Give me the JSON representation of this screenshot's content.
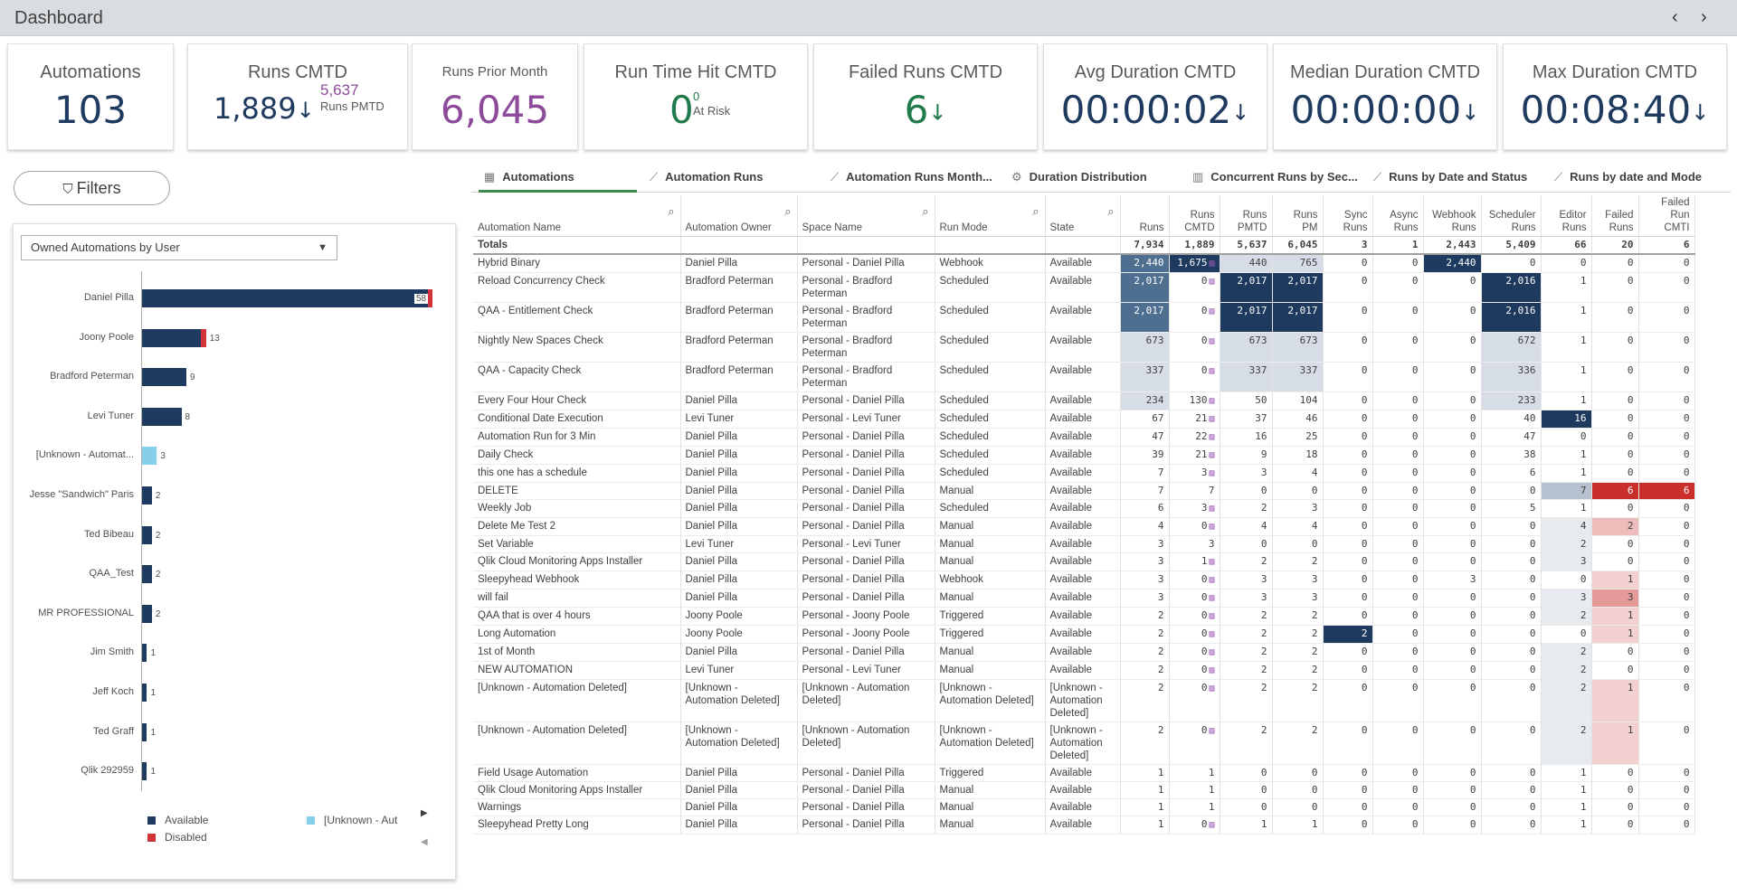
{
  "topbar": {
    "title": "Dashboard",
    "prev_icon": "‹",
    "next_icon": "›"
  },
  "kpis": [
    {
      "label": "Automations",
      "value": "103",
      "arrow": "",
      "sub_value": "",
      "sub_label": "",
      "value_color": "#1e3a5f"
    },
    {
      "label": "Runs CMTD",
      "value": "1,889",
      "arrow": "↓",
      "sub_value": "5,637",
      "sub_label": "Runs PMTD",
      "value_color": "#1e3a5f"
    },
    {
      "label": "Runs Prior Month",
      "value": "6,045",
      "arrow": "",
      "sub_value": "",
      "sub_label": "",
      "value_color": "#8e4a9a"
    },
    {
      "label": "Run Time Hit CMTD",
      "value": "0",
      "arrow": "",
      "sub_value": "0",
      "sub_label": "At Risk",
      "value_color": "#1f7a4c"
    },
    {
      "label": "Failed Runs CMTD",
      "value": "6",
      "arrow": "↓",
      "sub_value": "",
      "sub_label": "",
      "value_color": "#1f7a4c"
    },
    {
      "label": "Avg Duration CMTD",
      "value": "00:00:02",
      "arrow": "↓",
      "sub_value": "",
      "sub_label": "",
      "value_color": "#1e3a5f"
    },
    {
      "label": "Median Duration CMTD",
      "value": "00:00:00",
      "arrow": "↓",
      "sub_value": "",
      "sub_label": "",
      "value_color": "#1e3a5f"
    },
    {
      "label": "Max Duration CMTD",
      "value": "00:08:40",
      "arrow": "↓",
      "sub_value": "",
      "sub_label": "",
      "value_color": "#1e3a5f"
    }
  ],
  "filters": {
    "label": "Filters"
  },
  "chart_panel": {
    "dropdown_value": "Owned Automations by User",
    "legend": [
      {
        "label": "Available",
        "color": "#1e3a5f"
      },
      {
        "label": "Disabled",
        "color": "#d13438"
      },
      {
        "label": "[Unknown - Aut",
        "color": "#87ceeb"
      }
    ]
  },
  "chart_data": {
    "type": "bar",
    "orientation": "horizontal",
    "stacked": true,
    "categories": [
      "Daniel Pilla",
      "Joony Poole",
      "Bradford Peterman",
      "Levi Tuner",
      "[Unknown - Automat...",
      "Jesse \"Sandwich\" Paris",
      "Ted Bibeau",
      "QAA_Test",
      "MR PROFESSIONAL",
      "Jim Smith",
      "Jeff Koch",
      "Ted Graff",
      "Qlik 292959"
    ],
    "series": [
      {
        "name": "Available",
        "values": [
          58,
          12,
          9,
          8,
          0,
          2,
          2,
          2,
          2,
          1,
          1,
          1,
          1
        ],
        "color": "#1e3a5f"
      },
      {
        "name": "Disabled",
        "values": [
          1,
          1,
          0,
          0,
          0,
          0,
          0,
          0,
          0,
          0,
          0,
          0,
          0
        ],
        "color": "#d13438"
      },
      {
        "name": "[Unknown - Aut",
        "values": [
          0,
          0,
          0,
          0,
          3,
          0,
          0,
          0,
          0,
          0,
          0,
          0,
          0
        ],
        "color": "#87ceeb"
      }
    ],
    "labels": [
      "58",
      "13",
      "9",
      "8",
      "3",
      "2",
      "2",
      "2",
      "2",
      "1",
      "1",
      "1",
      "1"
    ]
  },
  "tabs": [
    {
      "label": "Automations",
      "icon": "▦"
    },
    {
      "label": "Automation Runs",
      "icon": "⟋"
    },
    {
      "label": "Automation Runs Month...",
      "icon": "⟋"
    },
    {
      "label": "Duration Distribution",
      "icon": "⚙"
    },
    {
      "label": "Concurrent Runs by Sec...",
      "icon": "▥"
    },
    {
      "label": "Runs by Date and Status",
      "icon": "⟋"
    },
    {
      "label": "Runs by date and Mode",
      "icon": "⟋"
    }
  ],
  "table": {
    "columns": [
      "Automation Name",
      "Automation Owner",
      "Space Name",
      "Run Mode",
      "State",
      "Runs",
      "Runs CMTD",
      "Runs PMTD",
      "Runs PM",
      "Sync Runs",
      "Async Runs",
      "Webhook Runs",
      "Scheduler Runs",
      "Editor Runs",
      "Failed Runs",
      "Failed Run CMTI"
    ],
    "totals": [
      "Totals",
      "",
      "",
      "",
      "",
      "7,934",
      "1,889",
      "5,637",
      "6,045",
      "3",
      "1",
      "2,443",
      "5,409",
      "66",
      "20",
      "6"
    ],
    "rows": [
      [
        "Hybrid Binary",
        "Daniel Pilla",
        "Personal - Daniel Pilla",
        "Webhook",
        "Available",
        "2,440",
        "1,675",
        "440",
        "765",
        "0",
        "0",
        "2,440",
        "0",
        "0",
        "0",
        "0"
      ],
      [
        "Reload Concurrency Check",
        "Bradford Peterman",
        "Personal - Bradford Peterman",
        "Scheduled",
        "Available",
        "2,017",
        "0",
        "2,017",
        "2,017",
        "0",
        "0",
        "0",
        "2,016",
        "1",
        "0",
        "0"
      ],
      [
        "QAA - Entitlement Check",
        "Bradford Peterman",
        "Personal - Bradford Peterman",
        "Scheduled",
        "Available",
        "2,017",
        "0",
        "2,017",
        "2,017",
        "0",
        "0",
        "0",
        "2,016",
        "1",
        "0",
        "0"
      ],
      [
        "Nightly New Spaces Check",
        "Bradford Peterman",
        "Personal - Bradford Peterman",
        "Scheduled",
        "Available",
        "673",
        "0",
        "673",
        "673",
        "0",
        "0",
        "0",
        "672",
        "1",
        "0",
        "0"
      ],
      [
        "QAA - Capacity Check",
        "Bradford Peterman",
        "Personal - Bradford Peterman",
        "Scheduled",
        "Available",
        "337",
        "0",
        "337",
        "337",
        "0",
        "0",
        "0",
        "336",
        "1",
        "0",
        "0"
      ],
      [
        "Every Four Hour Check",
        "Daniel Pilla",
        "Personal - Daniel Pilla",
        "Scheduled",
        "Available",
        "234",
        "130",
        "50",
        "104",
        "0",
        "0",
        "0",
        "233",
        "1",
        "0",
        "0"
      ],
      [
        "Conditional Date Execution",
        "Levi Tuner",
        "Personal - Levi Tuner",
        "Scheduled",
        "Available",
        "67",
        "21",
        "37",
        "46",
        "0",
        "0",
        "0",
        "40",
        "16",
        "0",
        "0"
      ],
      [
        "Automation Run for 3 Min",
        "Daniel Pilla",
        "Personal - Daniel Pilla",
        "Scheduled",
        "Available",
        "47",
        "22",
        "16",
        "25",
        "0",
        "0",
        "0",
        "47",
        "0",
        "0",
        "0"
      ],
      [
        "Daily Check",
        "Daniel Pilla",
        "Personal - Daniel Pilla",
        "Scheduled",
        "Available",
        "39",
        "21",
        "9",
        "18",
        "0",
        "0",
        "0",
        "38",
        "1",
        "0",
        "0"
      ],
      [
        "this one has a schedule",
        "Daniel Pilla",
        "Personal - Daniel Pilla",
        "Scheduled",
        "Available",
        "7",
        "3",
        "3",
        "4",
        "0",
        "0",
        "0",
        "6",
        "1",
        "0",
        "0"
      ],
      [
        "DELETE",
        "Daniel Pilla",
        "Personal - Daniel Pilla",
        "Manual",
        "Available",
        "7",
        "7",
        "0",
        "0",
        "0",
        "0",
        "0",
        "0",
        "7",
        "6",
        "6"
      ],
      [
        "Weekly Job",
        "Daniel Pilla",
        "Personal - Daniel Pilla",
        "Scheduled",
        "Available",
        "6",
        "3",
        "2",
        "3",
        "0",
        "0",
        "0",
        "5",
        "1",
        "0",
        "0"
      ],
      [
        "Delete Me Test 2",
        "Daniel Pilla",
        "Personal - Daniel Pilla",
        "Manual",
        "Available",
        "4",
        "0",
        "4",
        "4",
        "0",
        "0",
        "0",
        "0",
        "4",
        "2",
        "0"
      ],
      [
        "Set Variable",
        "Levi Tuner",
        "Personal - Levi Tuner",
        "Manual",
        "Available",
        "3",
        "3",
        "0",
        "0",
        "0",
        "0",
        "0",
        "0",
        "2",
        "0",
        "0"
      ],
      [
        "Qlik Cloud Monitoring Apps Installer",
        "Daniel Pilla",
        "Personal - Daniel Pilla",
        "Manual",
        "Available",
        "3",
        "1",
        "2",
        "2",
        "0",
        "0",
        "0",
        "0",
        "3",
        "0",
        "0"
      ],
      [
        "Sleepyhead Webhook",
        "Daniel Pilla",
        "Personal - Daniel Pilla",
        "Webhook",
        "Available",
        "3",
        "0",
        "3",
        "3",
        "0",
        "0",
        "3",
        "0",
        "0",
        "1",
        "0"
      ],
      [
        "will fail",
        "Daniel Pilla",
        "Personal - Daniel Pilla",
        "Manual",
        "Available",
        "3",
        "0",
        "3",
        "3",
        "0",
        "0",
        "0",
        "0",
        "3",
        "3",
        "0"
      ],
      [
        "QAA that is over 4 hours",
        "Joony Poole",
        "Personal - Joony Poole",
        "Triggered",
        "Available",
        "2",
        "0",
        "2",
        "2",
        "0",
        "0",
        "0",
        "0",
        "2",
        "1",
        "0"
      ],
      [
        "Long Automation",
        "Joony Poole",
        "Personal - Joony Poole",
        "Triggered",
        "Available",
        "2",
        "0",
        "2",
        "2",
        "2",
        "0",
        "0",
        "0",
        "0",
        "1",
        "0"
      ],
      [
        "1st of Month",
        "Daniel Pilla",
        "Personal - Daniel Pilla",
        "Manual",
        "Available",
        "2",
        "0",
        "2",
        "2",
        "0",
        "0",
        "0",
        "0",
        "2",
        "0",
        "0"
      ],
      [
        "NEW AUTOMATION",
        "Levi Tuner",
        "Personal - Levi Tuner",
        "Manual",
        "Available",
        "2",
        "0",
        "2",
        "2",
        "0",
        "0",
        "0",
        "0",
        "2",
        "0",
        "0"
      ],
      [
        "[Unknown - Automation Deleted]",
        "[Unknown - Automation Deleted]",
        "[Unknown - Automation Deleted]",
        "[Unknown - Automation Deleted]",
        "[Unknown - Automation Deleted]",
        "2",
        "0",
        "2",
        "2",
        "0",
        "0",
        "0",
        "0",
        "2",
        "1",
        "0"
      ],
      [
        "[Unknown - Automation Deleted]",
        "[Unknown - Automation Deleted]",
        "[Unknown - Automation Deleted]",
        "[Unknown - Automation Deleted]",
        "[Unknown - Automation Deleted]",
        "2",
        "0",
        "2",
        "2",
        "0",
        "0",
        "0",
        "0",
        "2",
        "1",
        "0"
      ],
      [
        "Field Usage Automation",
        "Daniel Pilla",
        "Personal - Daniel Pilla",
        "Triggered",
        "Available",
        "1",
        "1",
        "0",
        "0",
        "0",
        "0",
        "0",
        "0",
        "1",
        "0",
        "0"
      ],
      [
        "Qlik Cloud Monitoring Apps Installer",
        "Daniel Pilla",
        "Personal - Daniel Pilla",
        "Manual",
        "Available",
        "1",
        "1",
        "0",
        "0",
        "0",
        "0",
        "0",
        "0",
        "1",
        "0",
        "0"
      ],
      [
        "Warnings",
        "Daniel Pilla",
        "Personal - Daniel Pilla",
        "Manual",
        "Available",
        "1",
        "1",
        "0",
        "0",
        "0",
        "0",
        "0",
        "0",
        "1",
        "0",
        "0"
      ],
      [
        "Sleepyhead Pretty Long",
        "Daniel Pilla",
        "Personal - Daniel Pilla",
        "Manual",
        "Available",
        "1",
        "0",
        "1",
        "1",
        "0",
        "0",
        "0",
        "0",
        "1",
        "0",
        "0"
      ]
    ]
  },
  "colors": {
    "dark_navy": "#1e3a5f",
    "steel": "#4f6f91",
    "pale": "#d6dde6",
    "failed_red": "#c9302c",
    "failed_pale": "#f3d1d1",
    "green_accent": "#3d8c4e"
  }
}
